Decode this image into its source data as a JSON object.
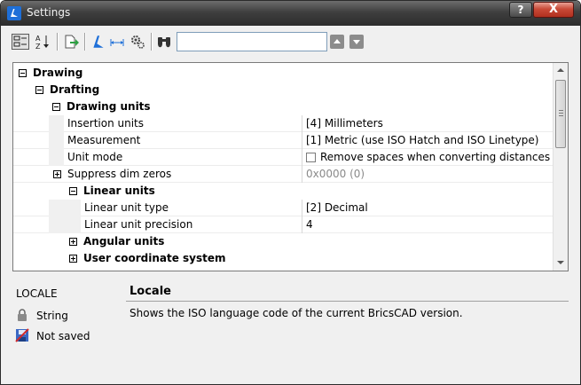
{
  "window": {
    "title": "Settings",
    "help_label": "?",
    "close_label": "X"
  },
  "toolbar": {
    "search_value": "",
    "search_placeholder": ""
  },
  "tree": {
    "rows": [
      {
        "label": "Drawing",
        "type": "category",
        "expanded": true
      },
      {
        "label": "Drafting",
        "type": "category",
        "expanded": true
      },
      {
        "label": "Drawing units",
        "type": "category",
        "expanded": true
      },
      {
        "label": "Insertion units",
        "value": "[4] Millimeters"
      },
      {
        "label": "Measurement",
        "value": "[1] Metric (use ISO Hatch and ISO Linetype)"
      },
      {
        "label": "Unit mode",
        "value": "Remove spaces when converting distances or a"
      },
      {
        "label": "Suppress dim zeros",
        "value": "0x0000 (0)",
        "collapsed": true
      },
      {
        "label": "Linear units",
        "type": "category",
        "expanded": true
      },
      {
        "label": "Linear unit type",
        "value": "[2] Decimal"
      },
      {
        "label": "Linear unit precision",
        "value": "4"
      },
      {
        "label": "Angular units",
        "type": "category",
        "collapsed": true
      },
      {
        "label": "User coordinate system",
        "type": "category",
        "collapsed": true
      }
    ]
  },
  "info": {
    "setting_name": "LOCALE",
    "type_label": "String",
    "saved_label": "Not saved",
    "title": "Locale",
    "description": "Shows the ISO language code of the current BricsCAD version."
  },
  "colors": {
    "accent": "#1e6fd8",
    "close_red": "#c94a37"
  },
  "icons": {
    "app": "bricscad-logo-icon",
    "categorized": "categorized-view-icon",
    "alphabetic": "sort-alphabetic-icon",
    "export": "export-icon",
    "filter_app": "bricscad-filter-icon",
    "dimension": "dimension-icon",
    "settings_gear": "gear-settings-icon",
    "find": "binoculars-icon",
    "prev": "arrow-up-icon",
    "next": "arrow-down-icon",
    "lock": "lock-icon",
    "not_saved": "not-saved-icon"
  }
}
